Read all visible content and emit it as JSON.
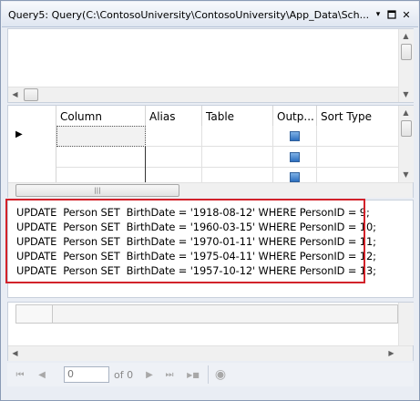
{
  "window": {
    "title": "Query5: Query(C:\\ContosoUniversity\\ContosoUniversity\\App_Data\\Sch...",
    "menu_glyph": "▾",
    "pin_glyph": "◻",
    "close_glyph": "✕"
  },
  "criteria_grid": {
    "columns": [
      "Column",
      "Alias",
      "Table",
      "Outp...",
      "Sort Type"
    ],
    "current_row_marker": "▶",
    "rows": [
      {
        "column": "",
        "alias": "",
        "table": "",
        "output": true,
        "sort_type": ""
      },
      {
        "column": "",
        "alias": "",
        "table": "",
        "output": true,
        "sort_type": ""
      },
      {
        "column": "",
        "alias": "",
        "table": "",
        "output": true,
        "sort_type": ""
      }
    ]
  },
  "sql_pane": {
    "lines": [
      "UPDATE  Person SET  BirthDate = '1918-08-12' WHERE PersonID = 9;",
      "UPDATE  Person SET  BirthDate = '1960-03-15' WHERE PersonID = 10;",
      "UPDATE  Person SET  BirthDate = '1970-01-11' WHERE PersonID = 11;",
      "UPDATE  Person SET  BirthDate = '1975-04-11' WHERE PersonID = 12;",
      "UPDATE  Person SET  BirthDate = '1957-10-12' WHERE PersonID = 13;"
    ]
  },
  "scroll_glyphs": {
    "up": "▲",
    "down": "▼",
    "left": "◀",
    "right": "▶",
    "grip": "|||"
  },
  "navigator": {
    "first_glyph": "⏮",
    "prev_glyph": "◀",
    "record_value": "0",
    "of_text": "of 0",
    "next_glyph": "▶",
    "last_glyph": "⏭",
    "delete_glyph": "▶■",
    "stop_glyph": "◉"
  },
  "colors": {
    "highlight": "#d2222a",
    "output_check": "#2d6fbf"
  }
}
